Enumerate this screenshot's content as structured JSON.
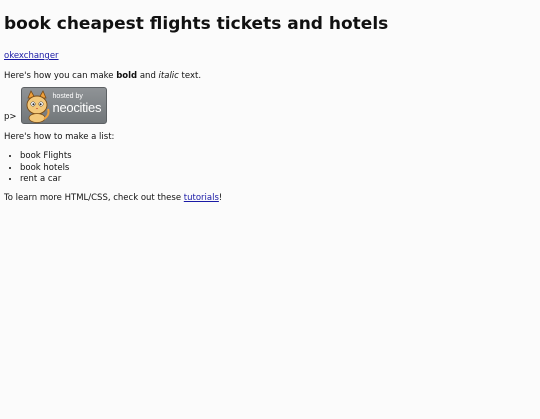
{
  "page": {
    "title": "book cheapest flights tickets and hotels",
    "link_text": "okexchanger",
    "intro_prefix": "Here's how you can make ",
    "bold_word": "bold",
    "intro_middle": " and ",
    "italic_word": "italic",
    "intro_suffix": " text.",
    "stray_text": "p>",
    "badge_small": "hosted by",
    "badge_big": "neocities",
    "list_intro": "Here's how to make a list:",
    "list_items": [
      "book Flights",
      "book hotels",
      "rent a car"
    ],
    "outro_prefix": "To learn more HTML/CSS, check out these ",
    "outro_link": "tutorials",
    "outro_suffix": "!"
  }
}
